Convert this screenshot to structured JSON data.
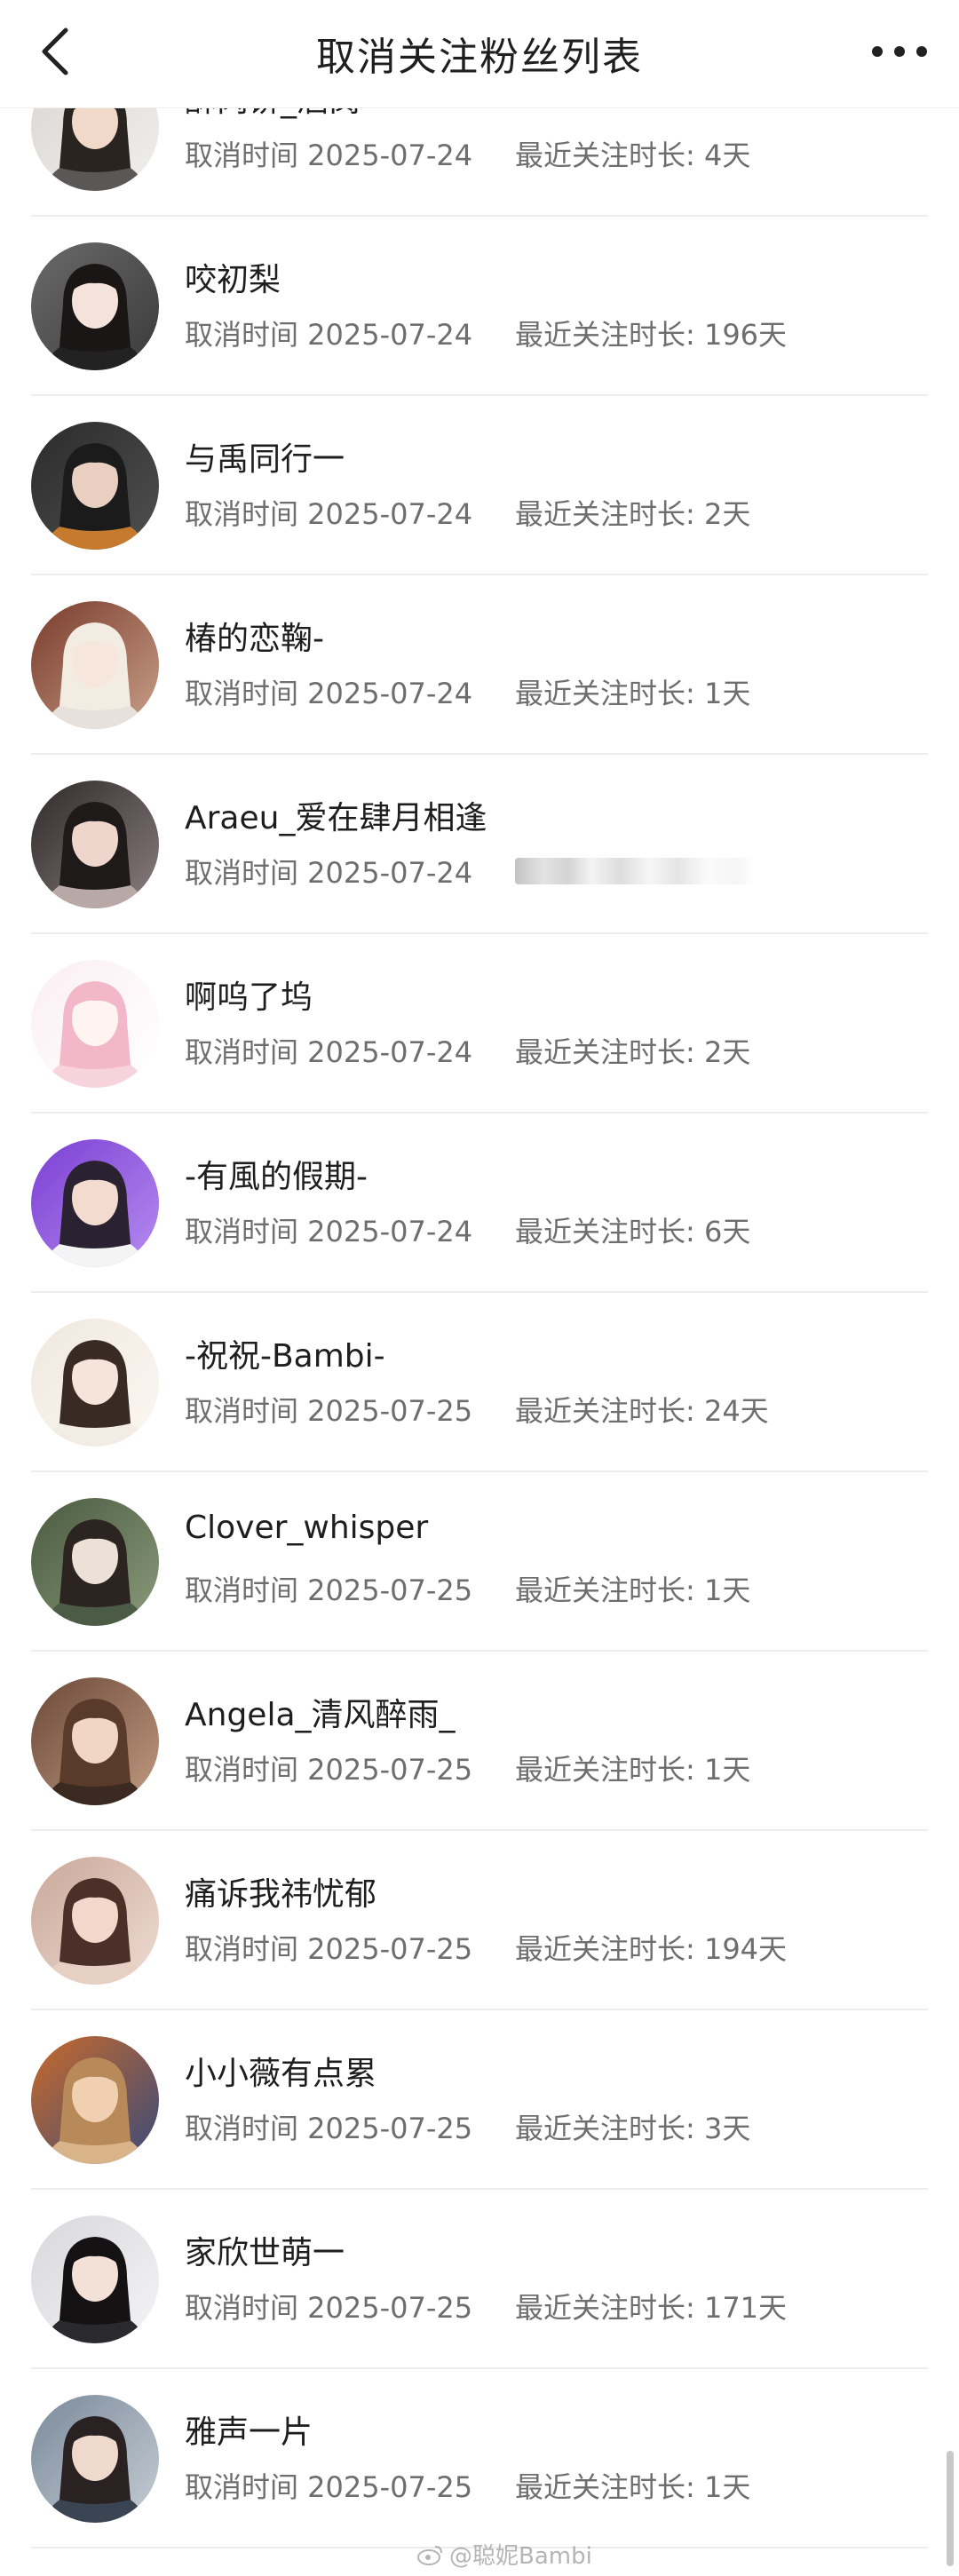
{
  "header": {
    "title": "取消关注粉丝列表",
    "back_icon": "back-arrow-icon",
    "more_icon": "more-dots-icon"
  },
  "fans": [
    {
      "name": "酥肉饼_酒窝",
      "cancel_time": "取消时间 2025-07-24",
      "duration": "最近关注时长: 4天",
      "avatar": {
        "bg1": "#d9d6d3",
        "bg2": "#f1efec",
        "skin": "#f0d9c8",
        "hair": "#2a2420",
        "cloth": "#5a5856"
      }
    },
    {
      "name": "咬初梨",
      "cancel_time": "取消时间 2025-07-24",
      "duration": "最近关注时长: 196天",
      "avatar": {
        "bg1": "#6a6a6a",
        "bg2": "#3a3a3a",
        "skin": "#f3e3da",
        "hair": "#1a1616",
        "cloth": "#222222"
      }
    },
    {
      "name": "与禹同行一",
      "cancel_time": "取消时间 2025-07-24",
      "duration": "最近关注时长: 2天",
      "avatar": {
        "bg1": "#2b2b2b",
        "bg2": "#505050",
        "skin": "#e9cfbf",
        "hair": "#1b1b1b",
        "cloth": "#c57a2e"
      }
    },
    {
      "name": "椿的恋鞠-",
      "cancel_time": "取消时间 2025-07-24",
      "duration": "最近关注时长: 1天",
      "avatar": {
        "bg1": "#7a3b2c",
        "bg2": "#c8a08a",
        "skin": "#f6e6dc",
        "hair": "#f3ece2",
        "cloth": "#e8e0da"
      }
    },
    {
      "name": "Araeu_爱在肆月相逢",
      "cancel_time": "取消时间 2025-07-24",
      "duration": "",
      "avatar": {
        "bg1": "#2f2a2a",
        "bg2": "#8a7e80",
        "skin": "#eed6cc",
        "hair": "#1e1a1a",
        "cloth": "#b9a9a6"
      }
    },
    {
      "name": "啊呜了坞",
      "cancel_time": "取消时间 2025-07-24",
      "duration": "最近关注时长: 2天",
      "avatar": {
        "bg1": "#fbeff3",
        "bg2": "#ffffff",
        "skin": "#fff4ef",
        "hair": "#f2b7c8",
        "cloth": "#f7d3de"
      }
    },
    {
      "name": "-有風的假期-",
      "cancel_time": "取消时间 2025-07-24",
      "duration": "最近关注时长: 6天",
      "avatar": {
        "bg1": "#7b3fd3",
        "bg2": "#b68cf0",
        "skin": "#f3dccf",
        "hair": "#2a2230",
        "cloth": "#f4f4f4"
      }
    },
    {
      "name": "-祝祝-Bambi-",
      "cancel_time": "取消时间 2025-07-25",
      "duration": "最近关注时长: 24天",
      "avatar": {
        "bg1": "#efe8df",
        "bg2": "#fbf7f1",
        "skin": "#f6e4da",
        "hair": "#3a2a24",
        "cloth": "#f3ece4"
      }
    },
    {
      "name": "Clover_whisper",
      "cancel_time": "取消时间 2025-07-25",
      "duration": "最近关注时长: 1天",
      "avatar": {
        "bg1": "#4a5a40",
        "bg2": "#8a9a7a",
        "skin": "#ede0d6",
        "hair": "#2c2420",
        "cloth": "#4b5b45"
      }
    },
    {
      "name": "Angela_清风醉雨_",
      "cancel_time": "取消时间 2025-07-25",
      "duration": "最近关注时长: 1天",
      "avatar": {
        "bg1": "#6b4a3a",
        "bg2": "#c29a80",
        "skin": "#f1d6c6",
        "hair": "#5a3a2a",
        "cloth": "#3a2a22"
      }
    },
    {
      "name": "痛诉我祎忧郁",
      "cancel_time": "取消时间 2025-07-25",
      "duration": "最近关注时长: 194天",
      "avatar": {
        "bg1": "#c9a89a",
        "bg2": "#efdcd2",
        "skin": "#f2d8cb",
        "hair": "#4a3028",
        "cloth": "#e6cfc3"
      }
    },
    {
      "name": "小小薇有点累",
      "cancel_time": "取消时间 2025-07-25",
      "duration": "最近关注时长: 3天",
      "avatar": {
        "bg1": "#c86a2a",
        "bg2": "#3a4a7a",
        "skin": "#f0d0b0",
        "hair": "#b88a5a",
        "cloth": "#d9b48a"
      }
    },
    {
      "name": "家欣世萌一",
      "cancel_time": "取消时间 2025-07-25",
      "duration": "最近关注时长: 171天",
      "avatar": {
        "bg1": "#d8d8dc",
        "bg2": "#f4f4f6",
        "skin": "#f3e0d6",
        "hair": "#151213",
        "cloth": "#2a2a2e"
      }
    },
    {
      "name": "雅声一片",
      "cancel_time": "取消时间 2025-07-25",
      "duration": "最近关注时长: 1天",
      "avatar": {
        "bg1": "#7a8a9a",
        "bg2": "#c6cdd4",
        "skin": "#efd8cc",
        "hair": "#2a2222",
        "cloth": "#3a4452"
      }
    }
  ],
  "watermark": {
    "text": "@聪妮Bambi",
    "icon": "weibo-icon"
  }
}
